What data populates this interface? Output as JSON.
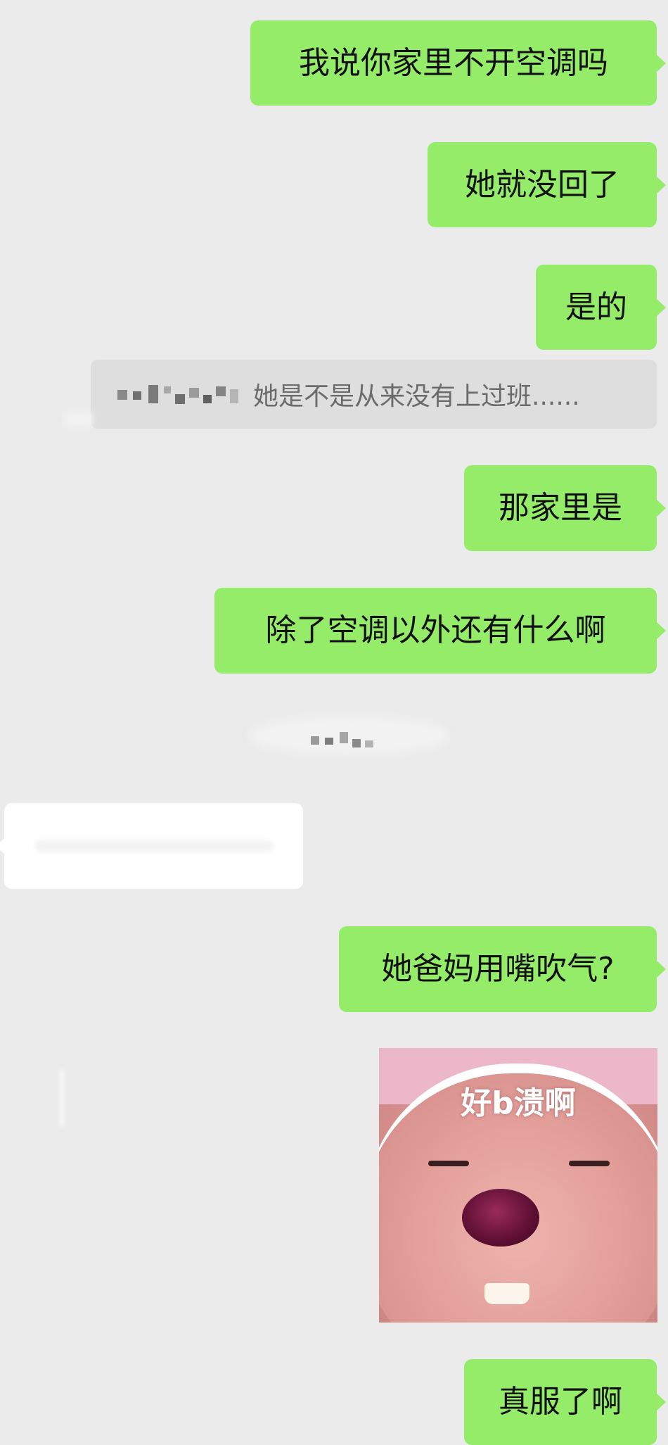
{
  "messages": [
    {
      "side": "sent",
      "text": "我说你家里不开空调吗"
    },
    {
      "side": "sent",
      "text": "她就没回了"
    },
    {
      "side": "sent",
      "text": "是的"
    },
    {
      "side": "sent",
      "text": "那家里是"
    },
    {
      "side": "sent",
      "text": "除了空调以外还有什么啊"
    },
    {
      "side": "sent",
      "text": "她爸妈用嘴吹气?"
    },
    {
      "side": "sent",
      "text": "真服了啊"
    }
  ],
  "quote": {
    "text": "她是不是从来没有上过班......"
  },
  "sticker": {
    "caption": "好b溃啊"
  },
  "colors": {
    "background": "#ebebeb",
    "sent_bubble": "#95ec69",
    "received_bubble": "#ffffff",
    "quote_bubble": "#dedede"
  }
}
